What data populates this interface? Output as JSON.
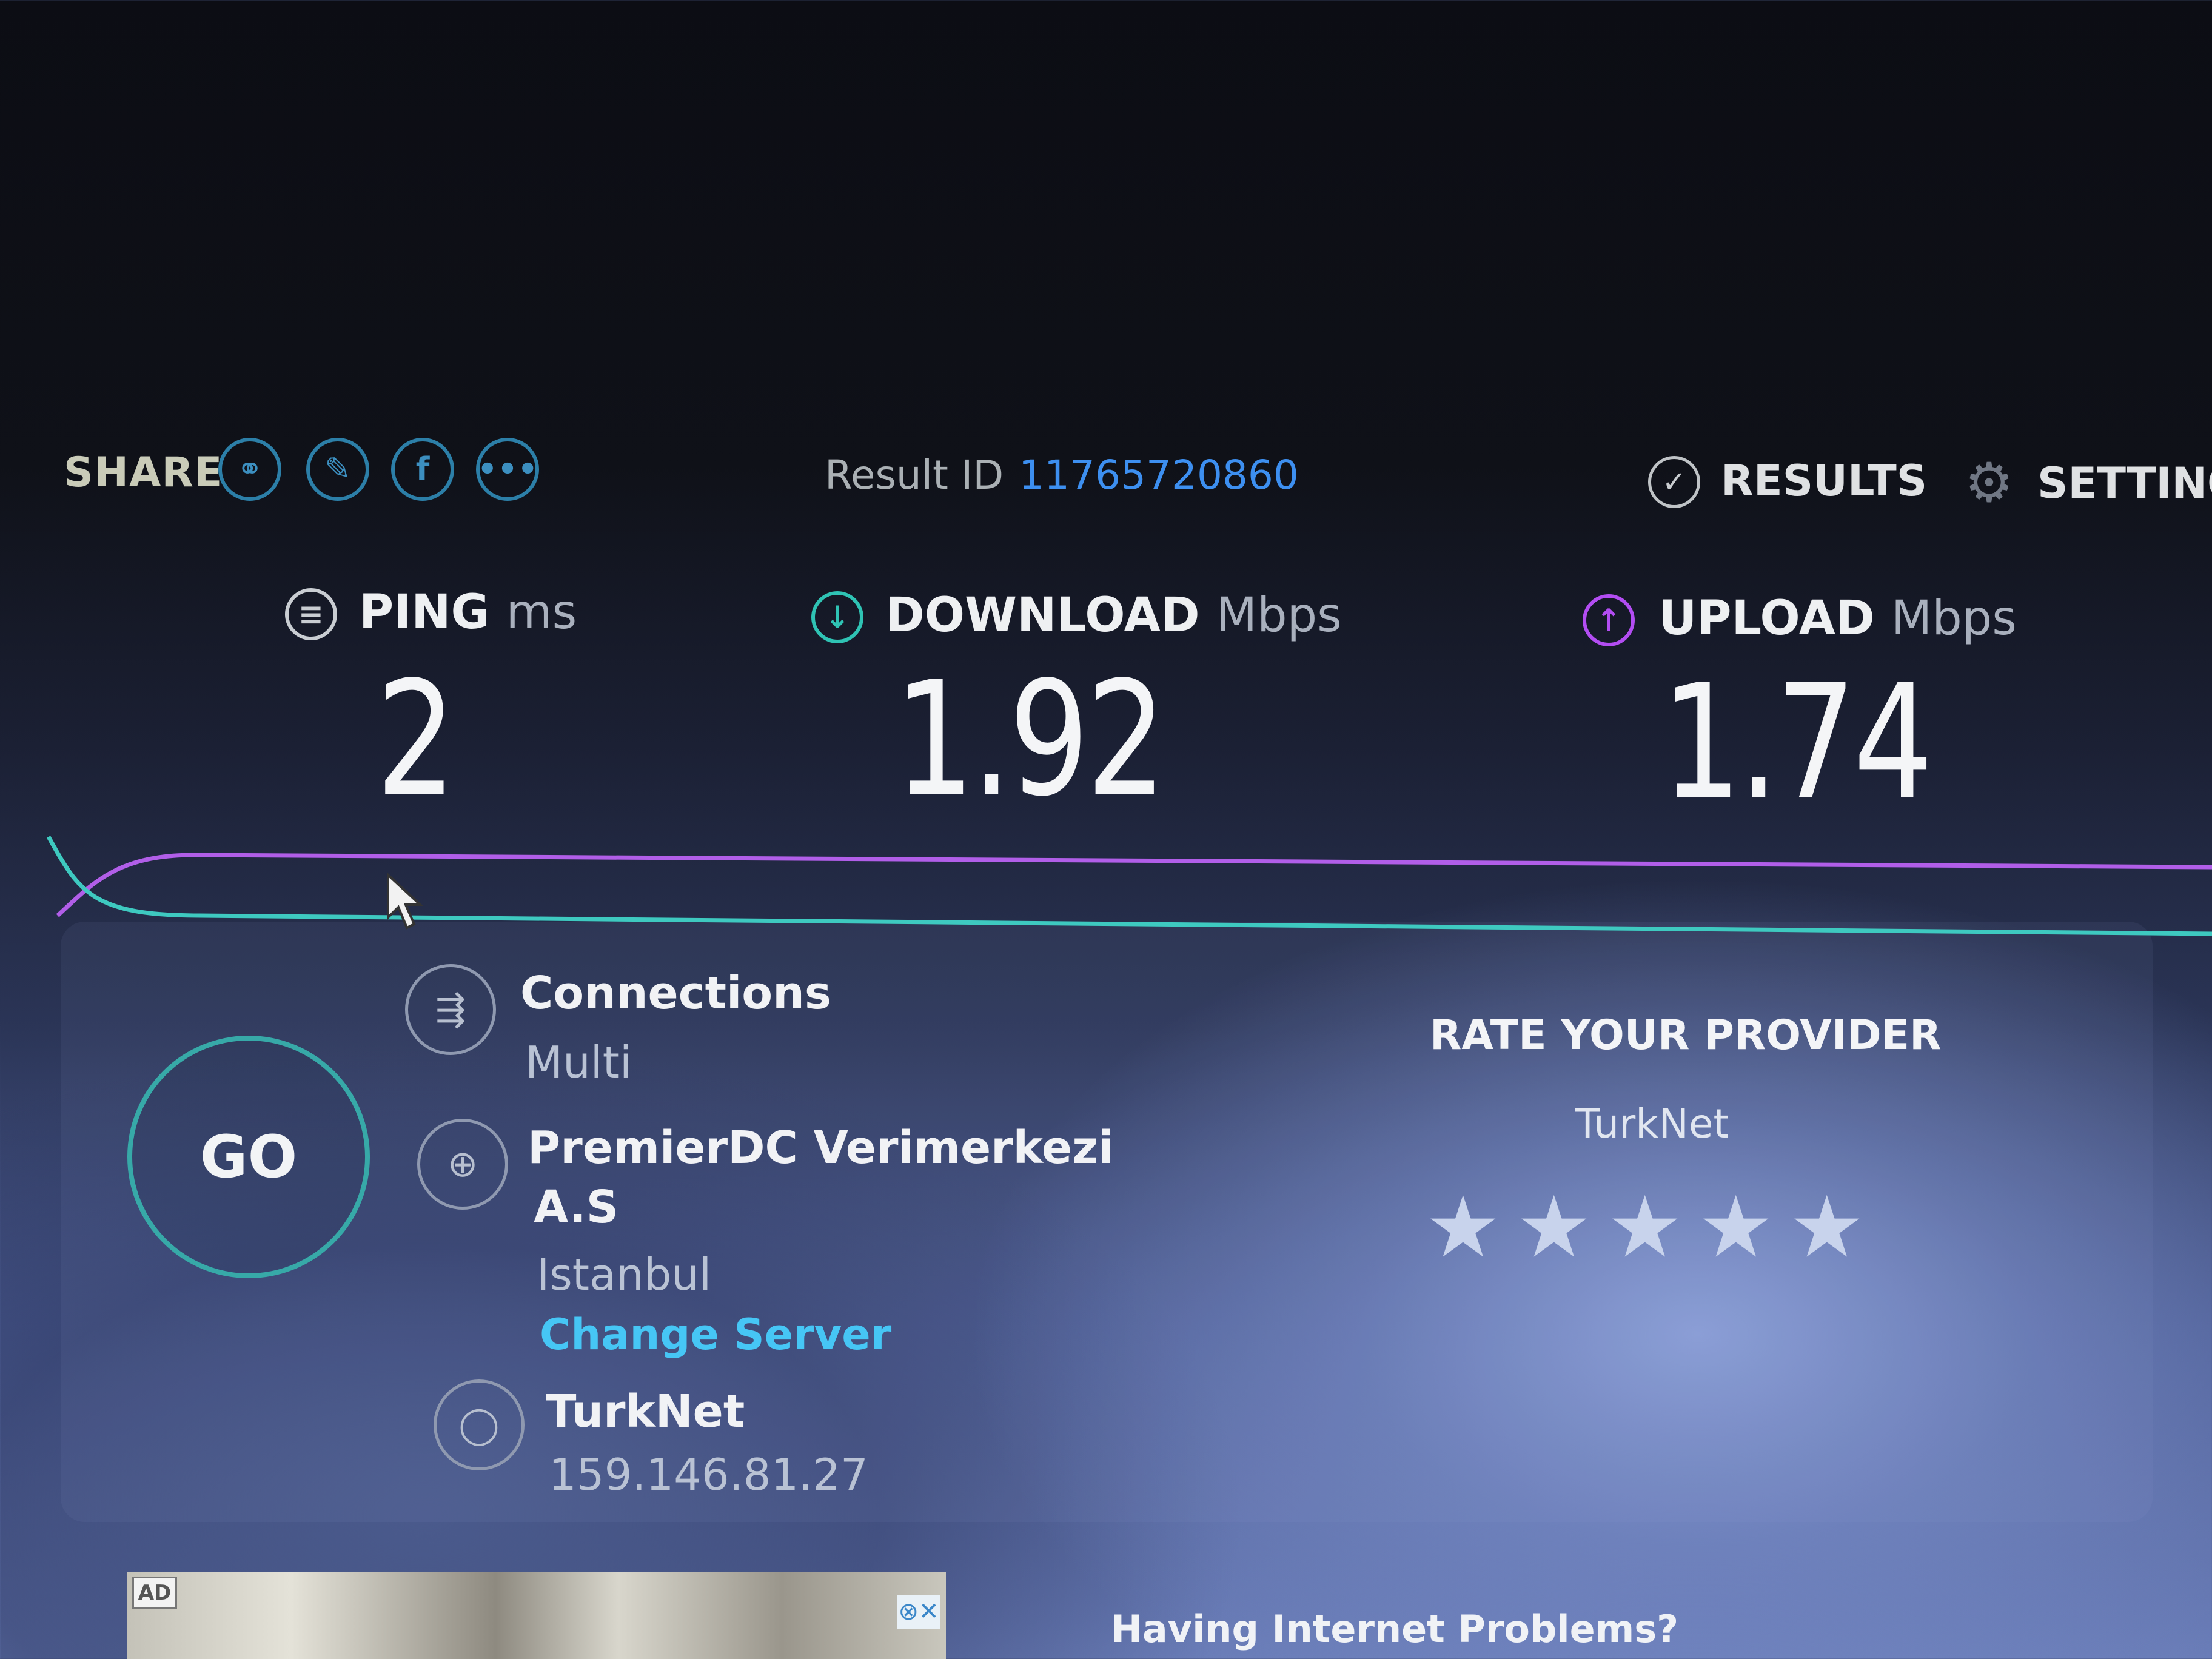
{
  "header": {
    "share_label": "SHARE",
    "share_icons": [
      "link-icon",
      "twitter-icon",
      "facebook-icon",
      "more-icon"
    ],
    "result_id_label": "Result ID",
    "result_id_value": "11765720860",
    "results_label": "RESULTS",
    "settings_label": "SETTING"
  },
  "metrics": {
    "ping": {
      "label": "PING",
      "unit": "ms",
      "value": "2",
      "color": "#c9cdd2"
    },
    "download": {
      "label": "DOWNLOAD",
      "unit": "Mbps",
      "value": "1.92",
      "color": "#2fc3b4"
    },
    "upload": {
      "label": "UPLOAD",
      "unit": "Mbps",
      "value": "1.74",
      "color": "#b34df2"
    }
  },
  "graph": {
    "download_color": "#3ec9c0",
    "upload_color": "#b15ee8"
  },
  "go_label": "GO",
  "connections": {
    "title": "Connections",
    "value": "Multi"
  },
  "server": {
    "name_line1": "PremierDC Verimerkezi",
    "name_line2": "A.S",
    "city": "Istanbul",
    "change_label": "Change Server"
  },
  "isp": {
    "name": "TurkNet",
    "ip": "159.146.81.27"
  },
  "rate": {
    "title": "RATE YOUR PROVIDER",
    "provider": "TurkNet",
    "stars": 5
  },
  "ad": {
    "badge": "AD",
    "close": "⊗✕",
    "headline": "Having Internet Problems?"
  }
}
